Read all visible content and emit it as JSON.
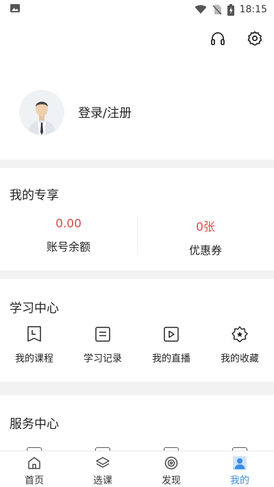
{
  "status": {
    "time": "18:15"
  },
  "header": {
    "icons": [
      "headset-icon",
      "settings-icon"
    ]
  },
  "profile": {
    "login_label": "登录/注册"
  },
  "exclusive": {
    "title": "我的专享",
    "items": [
      {
        "value": "0.00",
        "label": "账号余额"
      },
      {
        "value": "0张",
        "label": "优惠券"
      }
    ]
  },
  "study": {
    "title": "学习中心",
    "items": [
      {
        "label": "我的课程",
        "icon": "course-icon"
      },
      {
        "label": "学习记录",
        "icon": "record-icon"
      },
      {
        "label": "我的直播",
        "icon": "live-icon"
      },
      {
        "label": "我的收藏",
        "icon": "favorite-icon"
      }
    ]
  },
  "service": {
    "title": "服务中心"
  },
  "nav": {
    "items": [
      {
        "label": "首页",
        "icon": "home-icon"
      },
      {
        "label": "选课",
        "icon": "layers-icon"
      },
      {
        "label": "发现",
        "icon": "discover-icon"
      },
      {
        "label": "我的",
        "icon": "user-icon"
      }
    ],
    "active_index": 3
  },
  "colors": {
    "accent": "#3a8ee6",
    "value_red": "#e04b4b"
  }
}
